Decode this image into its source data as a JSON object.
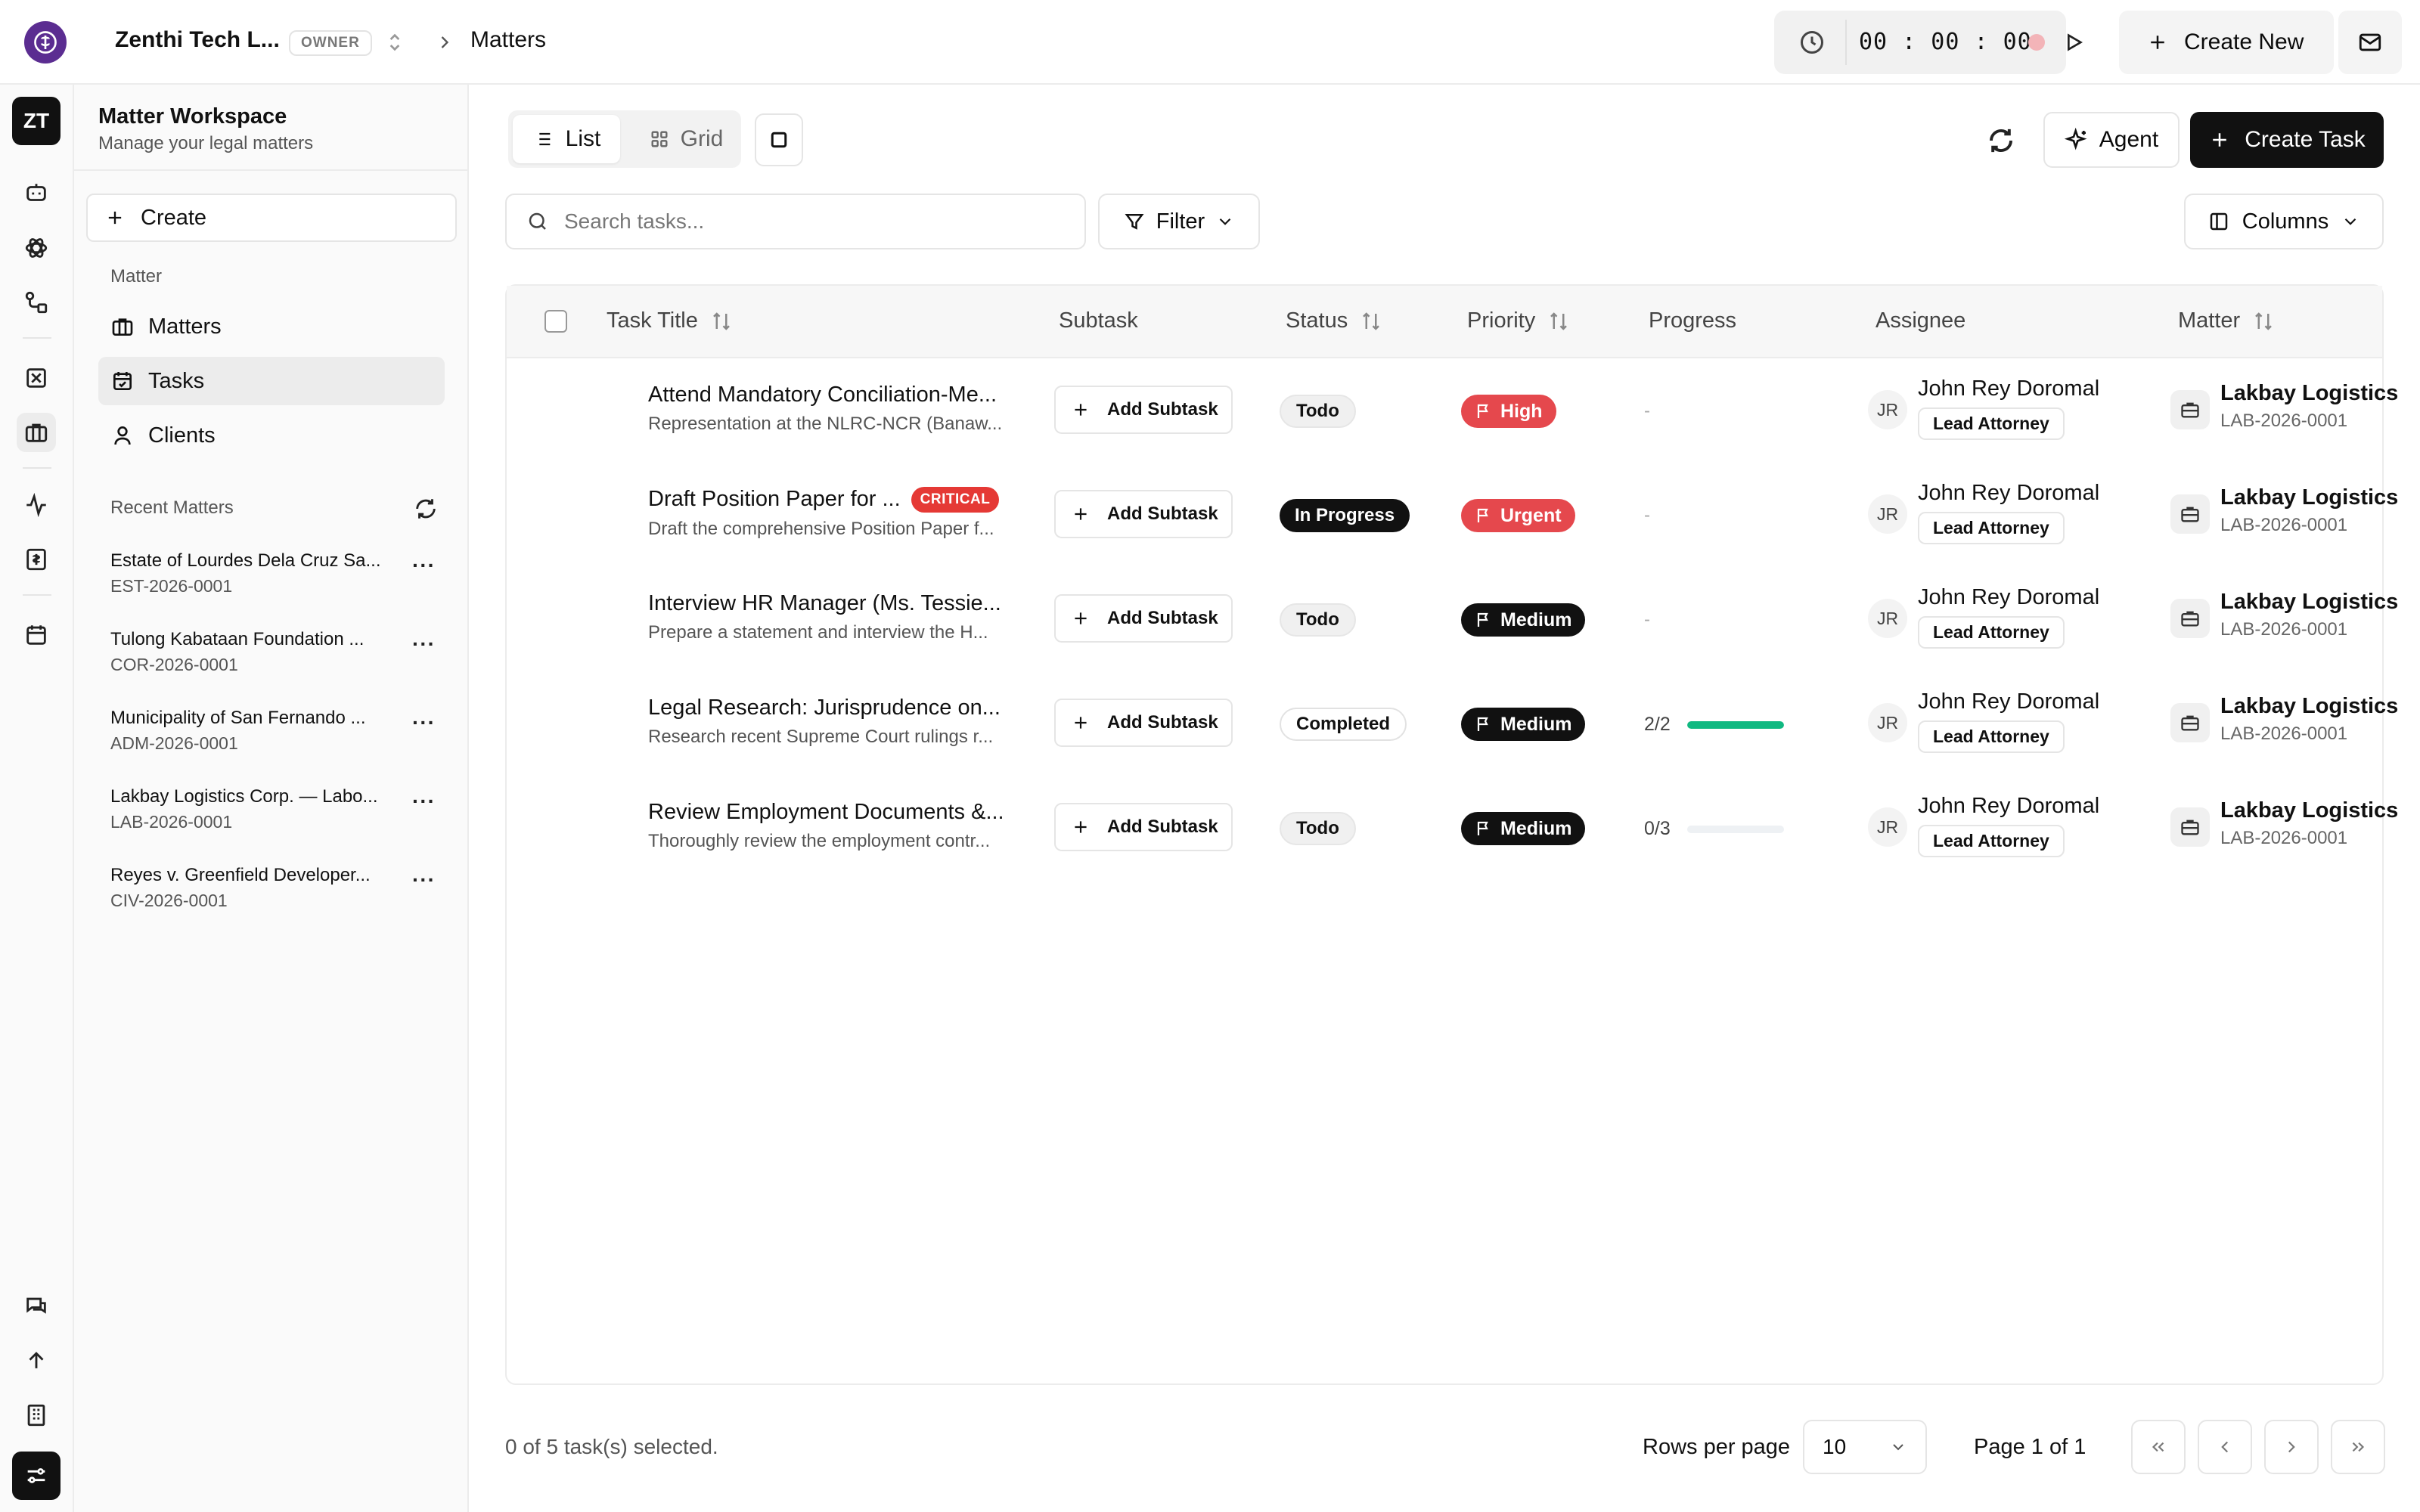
{
  "header": {
    "org_name": "Zenthi Tech L...",
    "owner_badge": "OWNER",
    "breadcrumb": "Matters",
    "timer": "00 : 00 : 00",
    "create_new": "Create New"
  },
  "rail": {
    "avatar": "ZT",
    "icons": [
      "chat-bot-icon",
      "atom-icon",
      "workflow-icon",
      "spreadsheet-icon",
      "briefcase-icon",
      "activity-icon",
      "billing-icon",
      "calendar-icon",
      "messages-icon",
      "arrow-up-icon",
      "building-icon",
      "settings-sliders-icon"
    ]
  },
  "panel": {
    "title": "Matter Workspace",
    "subtitle": "Manage your legal matters",
    "create": "Create",
    "section": "Matter",
    "nav": [
      {
        "label": "Matters"
      },
      {
        "label": "Tasks"
      },
      {
        "label": "Clients"
      }
    ],
    "recent_label": "Recent Matters",
    "recent": [
      {
        "name": "Estate of Lourdes Dela Cruz Sa...",
        "code": "EST-2026-0001"
      },
      {
        "name": "Tulong Kabataan Foundation ...",
        "code": "COR-2026-0001"
      },
      {
        "name": "Municipality of San Fernando ...",
        "code": "ADM-2026-0001"
      },
      {
        "name": "Lakbay Logistics Corp. — Labo...",
        "code": "LAB-2026-0001"
      },
      {
        "name": "Reyes v. Greenfield Developer...",
        "code": "CIV-2026-0001"
      }
    ]
  },
  "toolbar": {
    "list": "List",
    "grid": "Grid",
    "agent": "Agent",
    "create_task": "Create Task",
    "search_placeholder": "Search tasks...",
    "filter": "Filter",
    "columns": "Columns"
  },
  "table": {
    "headers": {
      "title": "Task Title",
      "subtask": "Subtask",
      "status": "Status",
      "priority": "Priority",
      "progress": "Progress",
      "assignee": "Assignee",
      "matter": "Matter"
    },
    "add_subtask": "Add Subtask",
    "rows": [
      {
        "title": "Attend Mandatory Conciliation-Me...",
        "desc": "Representation at the NLRC-NCR (Banaw...",
        "badge": "",
        "status": "Todo",
        "priority": "High",
        "progress": "-",
        "progress_fraction": null,
        "initials": "JR",
        "assignee": "John Rey Doromal",
        "role": "Lead Attorney",
        "matter": "Lakbay Logistics",
        "matter_code": "LAB-2026-0001"
      },
      {
        "title": "Draft Position Paper for ...",
        "desc": "Draft the comprehensive Position Paper f...",
        "badge": "CRITICAL",
        "status": "In Progress",
        "priority": "Urgent",
        "progress": "-",
        "progress_fraction": null,
        "initials": "JR",
        "assignee": "John Rey Doromal",
        "role": "Lead Attorney",
        "matter": "Lakbay Logistics",
        "matter_code": "LAB-2026-0001"
      },
      {
        "title": "Interview HR Manager (Ms. Tessie...",
        "desc": "Prepare a statement and interview the H...",
        "badge": "",
        "status": "Todo",
        "priority": "Medium",
        "progress": "-",
        "progress_fraction": null,
        "initials": "JR",
        "assignee": "John Rey Doromal",
        "role": "Lead Attorney",
        "matter": "Lakbay Logistics",
        "matter_code": "LAB-2026-0001"
      },
      {
        "title": "Legal Research: Jurisprudence on...",
        "desc": "Research recent Supreme Court rulings r...",
        "badge": "",
        "status": "Completed",
        "priority": "Medium",
        "progress": "2/2",
        "progress_fraction": 1.0,
        "initials": "JR",
        "assignee": "John Rey Doromal",
        "role": "Lead Attorney",
        "matter": "Lakbay Logistics",
        "matter_code": "LAB-2026-0001"
      },
      {
        "title": "Review Employment Documents &...",
        "desc": "Thoroughly review the employment contr...",
        "badge": "",
        "status": "Todo",
        "priority": "Medium",
        "progress": "0/3",
        "progress_fraction": 0.0,
        "initials": "JR",
        "assignee": "John Rey Doromal",
        "role": "Lead Attorney",
        "matter": "Lakbay Logistics",
        "matter_code": "LAB-2026-0001"
      }
    ]
  },
  "footer": {
    "selection": "0 of 5 task(s) selected.",
    "rows_per_page_label": "Rows per page",
    "rows_per_page": "10",
    "page_label": "Page 1 of 1"
  },
  "colors": {
    "brand": "#5b2d91",
    "danger": "#e5484d",
    "success": "#10b981",
    "primary": "#111111"
  }
}
